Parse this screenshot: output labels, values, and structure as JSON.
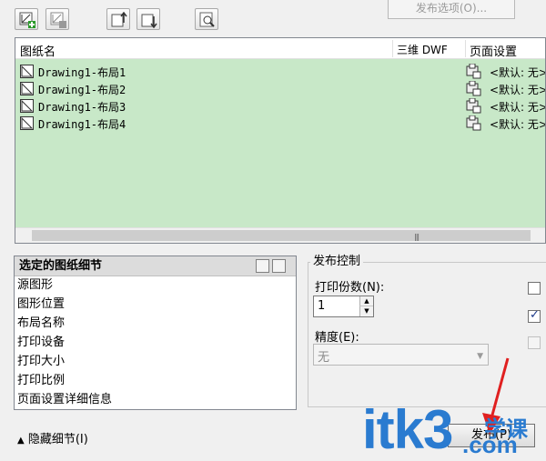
{
  "toolbar": {
    "publish_options_label": "发布选项(O)..."
  },
  "sheet_list": {
    "col_sheet_name": "图纸名",
    "col_3d_dwf": "三维 DWF",
    "col_page_setup": "页面设置",
    "rows": [
      {
        "name": "Drawing1-布局1",
        "page_setup": "<默认: 无>"
      },
      {
        "name": "Drawing1-布局2",
        "page_setup": "<默认: 无>"
      },
      {
        "name": "Drawing1-布局3",
        "page_setup": "<默认: 无>"
      },
      {
        "name": "Drawing1-布局4",
        "page_setup": "<默认: 无>"
      }
    ],
    "list_bg_color": "#c8e8c8"
  },
  "details": {
    "title": "选定的图纸细节",
    "items": [
      "源图形",
      "图形位置",
      "布局名称",
      "打印设备",
      "打印大小",
      "打印比例",
      "页面设置详细信息"
    ]
  },
  "hide_details_label": "隐藏细节(I)",
  "publish_control": {
    "title": "发布控制",
    "copies_label": "打印份数(N):",
    "copies_value": "1",
    "precision_label": "精度(E):",
    "precision_value": "无",
    "checkboxes": [
      {
        "checked": false,
        "enabled": true
      },
      {
        "checked": true,
        "enabled": true
      },
      {
        "checked": false,
        "enabled": false
      }
    ]
  },
  "publish_button_label": "发布(P)",
  "watermark": {
    "brand": "itk3",
    "domain": ".com",
    "cn": "学课"
  },
  "colors": {
    "accent": "#2a7bd0",
    "list_green": "#c8e8c8"
  }
}
